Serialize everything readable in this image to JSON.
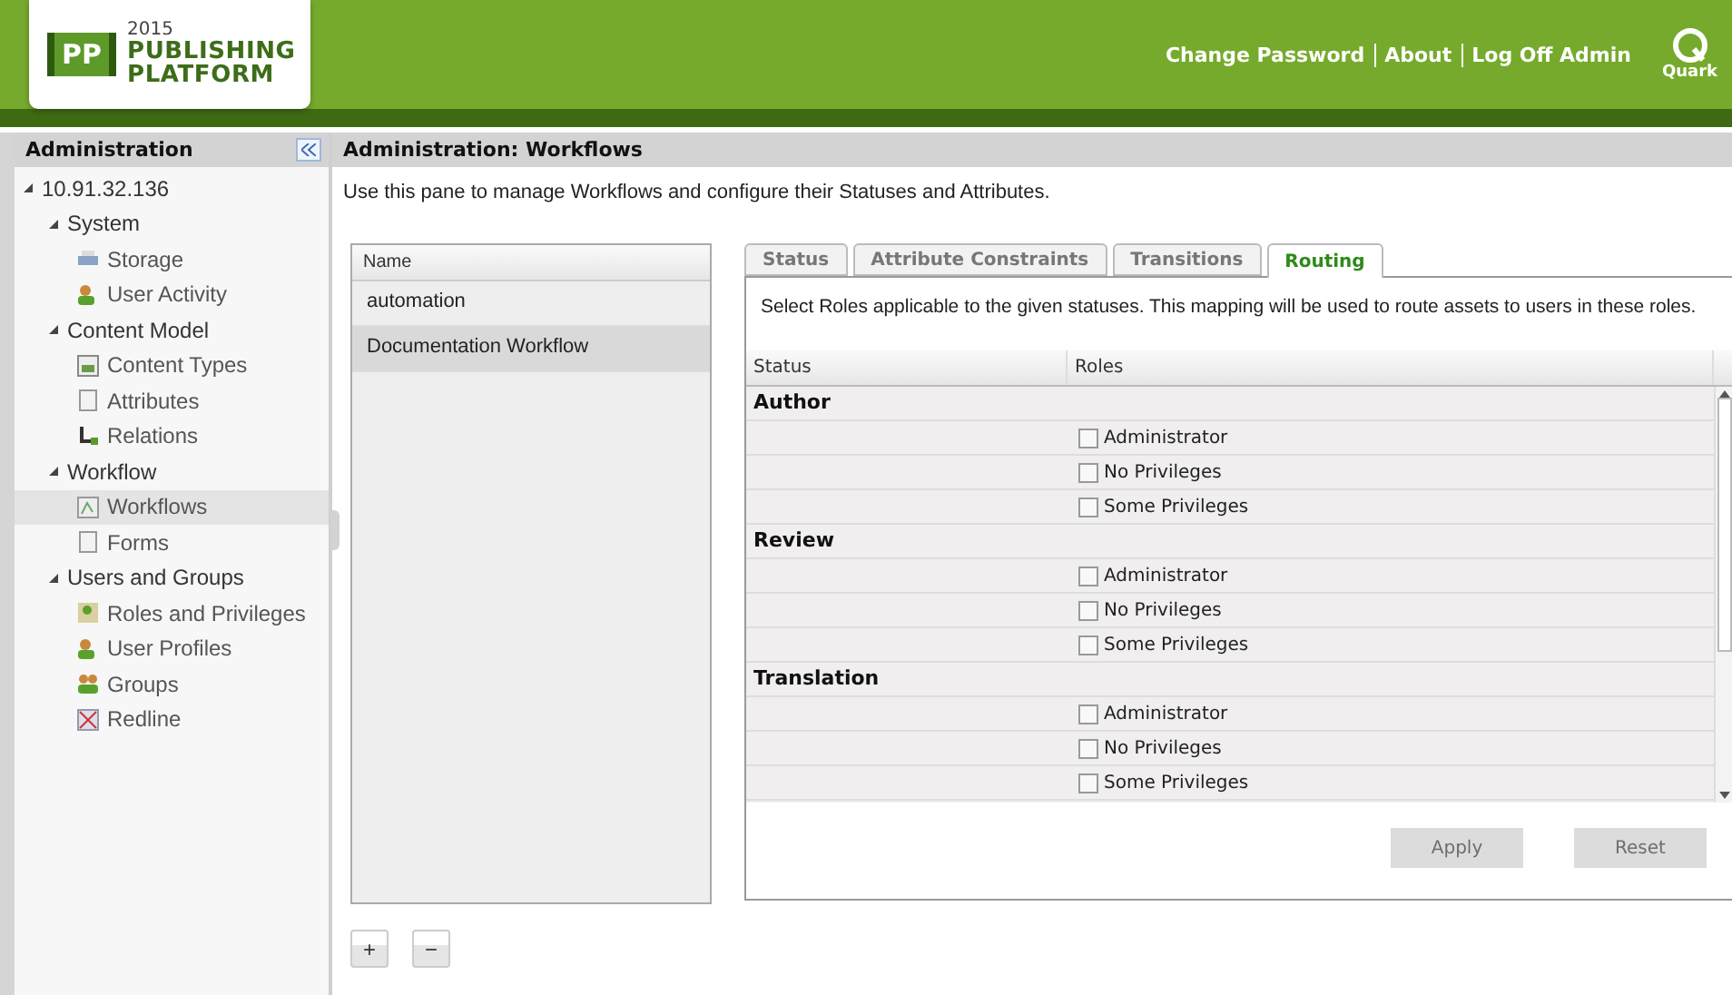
{
  "header": {
    "logo_mark": "PP",
    "logo_year": "2015",
    "logo_line1": "PUBLISHING",
    "logo_line2": "PLATFORM",
    "links": [
      "Change Password",
      "About",
      "Log Off Admin"
    ],
    "brand": "Quark"
  },
  "sidebar": {
    "title": "Administration",
    "tree": [
      {
        "label": "10.91.32.136",
        "expanded": true,
        "children": [
          {
            "label": "System",
            "expanded": true,
            "children": [
              {
                "label": "Storage",
                "kind": "storage",
                "selected": false
              },
              {
                "label": "User Activity",
                "kind": "user",
                "selected": false
              }
            ]
          },
          {
            "label": "Content Model",
            "expanded": true,
            "children": [
              {
                "label": "Content Types",
                "kind": "image",
                "selected": false
              },
              {
                "label": "Attributes",
                "kind": "page",
                "selected": false
              },
              {
                "label": "Relations",
                "kind": "relation",
                "selected": false
              }
            ]
          },
          {
            "label": "Workflow",
            "expanded": true,
            "children": [
              {
                "label": "Workflows",
                "kind": "workflow",
                "selected": true
              },
              {
                "label": "Forms",
                "kind": "page",
                "selected": false
              }
            ]
          },
          {
            "label": "Users and Groups",
            "expanded": true,
            "children": [
              {
                "label": "Roles and Privileges",
                "kind": "roles",
                "selected": false
              },
              {
                "label": "User Profiles",
                "kind": "user",
                "selected": false
              },
              {
                "label": "Groups",
                "kind": "group",
                "selected": false
              },
              {
                "label": "Redline",
                "kind": "redline",
                "selected": false
              }
            ]
          }
        ]
      }
    ]
  },
  "main": {
    "title": "Administration: Workflows",
    "description": "Use this pane to manage Workflows and configure their Statuses and Attributes.",
    "workflows": {
      "column": "Name",
      "rows": [
        {
          "name": "automation",
          "selected": false
        },
        {
          "name": "Documentation Workflow",
          "selected": true
        }
      ]
    },
    "tabs": [
      {
        "label": "Status",
        "selected": false
      },
      {
        "label": "Attribute Constraints",
        "selected": false
      },
      {
        "label": "Transitions",
        "selected": false
      },
      {
        "label": "Routing",
        "selected": true
      }
    ],
    "routing": {
      "description": "Select Roles applicable to the given statuses. This mapping will be used to route assets to users in these roles.",
      "columns": [
        "Status",
        "Roles"
      ],
      "groups": [
        {
          "status": "Author",
          "roles": [
            {
              "label": "Administrator",
              "checked": false
            },
            {
              "label": "No Privileges",
              "checked": false
            },
            {
              "label": "Some Privileges",
              "checked": false
            }
          ]
        },
        {
          "status": "Review",
          "roles": [
            {
              "label": "Administrator",
              "checked": false
            },
            {
              "label": "No Privileges",
              "checked": false
            },
            {
              "label": "Some Privileges",
              "checked": false
            }
          ]
        },
        {
          "status": "Translation",
          "roles": [
            {
              "label": "Administrator",
              "checked": false
            },
            {
              "label": "No Privileges",
              "checked": false
            },
            {
              "label": "Some Privileges",
              "checked": false
            }
          ]
        }
      ]
    },
    "buttons": [
      {
        "label": "Apply",
        "disabled": true
      },
      {
        "label": "Reset",
        "disabled": true
      }
    ],
    "list_buttons": [
      "+",
      "−"
    ]
  }
}
